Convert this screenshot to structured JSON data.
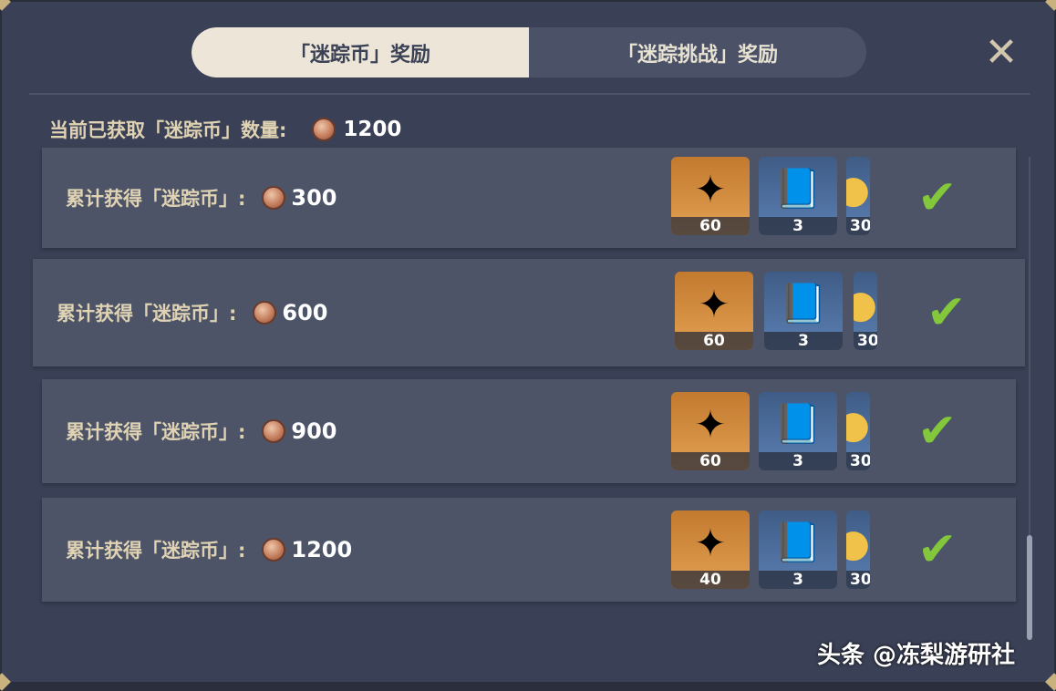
{
  "tabs": [
    {
      "label": "「迷踪币」奖励",
      "active": true
    },
    {
      "label": "「迷踪挑战」奖励",
      "active": false
    }
  ],
  "close_icon": "close-icon",
  "current": {
    "label": "当前已获取「迷踪币」数量:",
    "value": "1200",
    "icon": "coin-icon"
  },
  "rows": [
    {
      "label": "累计获得「迷踪币」:",
      "amount": "300",
      "rewards": [
        "60",
        "3",
        "30"
      ],
      "claimed": true
    },
    {
      "label": "累计获得「迷踪币」:",
      "amount": "600",
      "rewards": [
        "60",
        "3",
        "30"
      ],
      "claimed": true
    },
    {
      "label": "累计获得「迷踪币」:",
      "amount": "900",
      "rewards": [
        "60",
        "3",
        "30"
      ],
      "claimed": true
    },
    {
      "label": "累计获得「迷踪币」:",
      "amount": "1200",
      "rewards": [
        "40",
        "3",
        "30"
      ],
      "claimed": true
    }
  ],
  "watermark": "头条 @冻梨游研社",
  "colors": {
    "accent_gold": "#e0d3b4",
    "check_green": "#83c83a",
    "panel": "#3a4055"
  }
}
